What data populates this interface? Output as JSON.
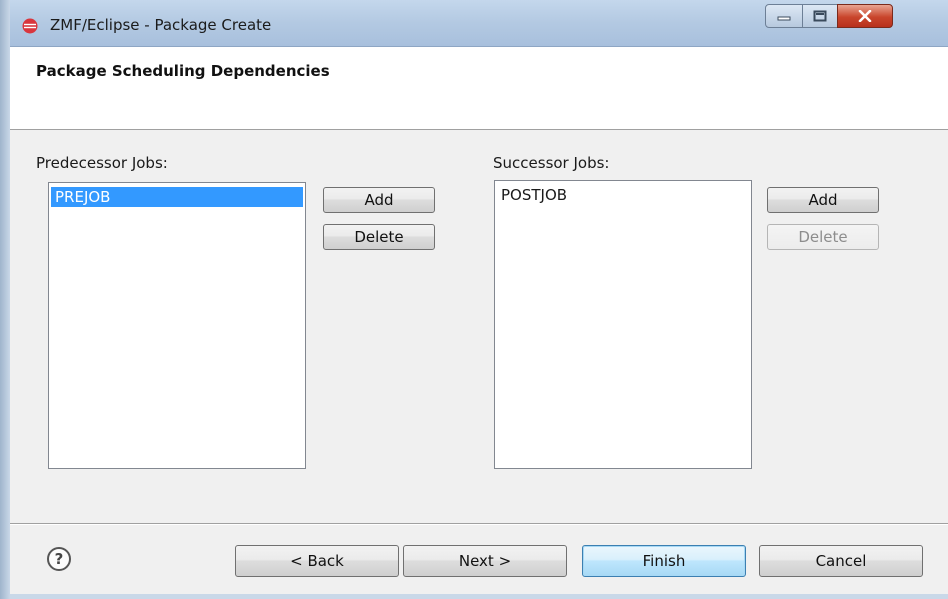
{
  "window": {
    "title": "ZMF/Eclipse - Package Create",
    "icon": "eclipse-logo-icon"
  },
  "header": {
    "title": "Package Scheduling Dependencies"
  },
  "predecessor": {
    "label": "Predecessor Jobs:",
    "items": [
      "PREJOB"
    ],
    "selected_index": 0,
    "add_label": "Add",
    "delete_label": "Delete"
  },
  "successor": {
    "label": "Successor Jobs:",
    "items": [
      "POSTJOB"
    ],
    "add_label": "Add",
    "delete_label": "Delete"
  },
  "footer": {
    "help_icon": "help-icon",
    "back_label": "< Back",
    "next_label": "Next >",
    "finish_label": "Finish",
    "cancel_label": "Cancel"
  },
  "colors": {
    "selection": "#3399ff",
    "titlebar": "#b3c9e2",
    "close_button": "#c9452c"
  }
}
